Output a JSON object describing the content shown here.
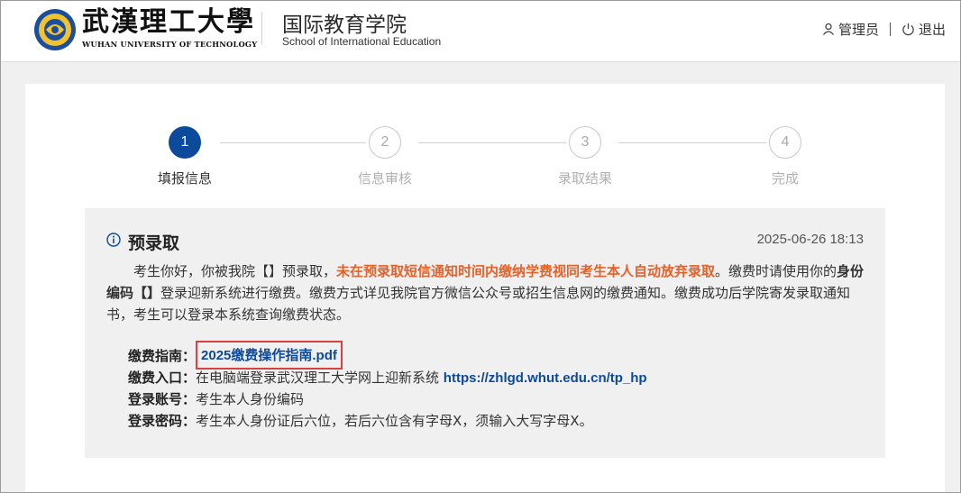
{
  "header": {
    "university_cn": "武漢理工大學",
    "university_en": "WUHAN UNIVERSITY OF TECHNOLOGY",
    "school_cn": "国际教育学院",
    "school_en": "School of International Education",
    "user_label": "管理员",
    "logout_label": "退出"
  },
  "steps": [
    {
      "number": "1",
      "label": "填报信息",
      "state": "active"
    },
    {
      "number": "2",
      "label": "信息审核",
      "state": "inactive"
    },
    {
      "number": "3",
      "label": "录取结果",
      "state": "inactive"
    },
    {
      "number": "4",
      "label": "完成",
      "state": "inactive"
    }
  ],
  "notice": {
    "title": "预录取",
    "time": "2025-06-26 18:13",
    "body_part1": "考生你好，你被我院【】预录取，",
    "body_warning": "未在预录取短信通知时间内缴纳学费视同考生本人自动放弃录取",
    "body_part2": "。缴费时请使用你的",
    "body_bold": "身份编码【】",
    "body_part3": "登录迎新系统进行缴费。缴费方式详见我院官方微信公众号或招生信息网的缴费通知。缴费成功后学院寄发录取通知书，考生可以登录本系统查询缴费状态。",
    "guide_key": "缴费指南：",
    "guide_link": "2025缴费操作指南.pdf",
    "entry_key": "缴费入口：",
    "entry_text": "在电脑端登录武汉理工大学网上迎新系统 ",
    "entry_link": "https://zhlgd.whut.edu.cn/tp_hp",
    "account_key": "登录账号：",
    "account_value": "考生本人身份编码",
    "password_key": "登录密码：",
    "password_value": "考生本人身份证后六位，若后六位含有字母X，须输入大写字母X。"
  },
  "colors": {
    "primary": "#0c4a9c",
    "warning": "#e3622a",
    "highlight_box": "#d94141"
  }
}
